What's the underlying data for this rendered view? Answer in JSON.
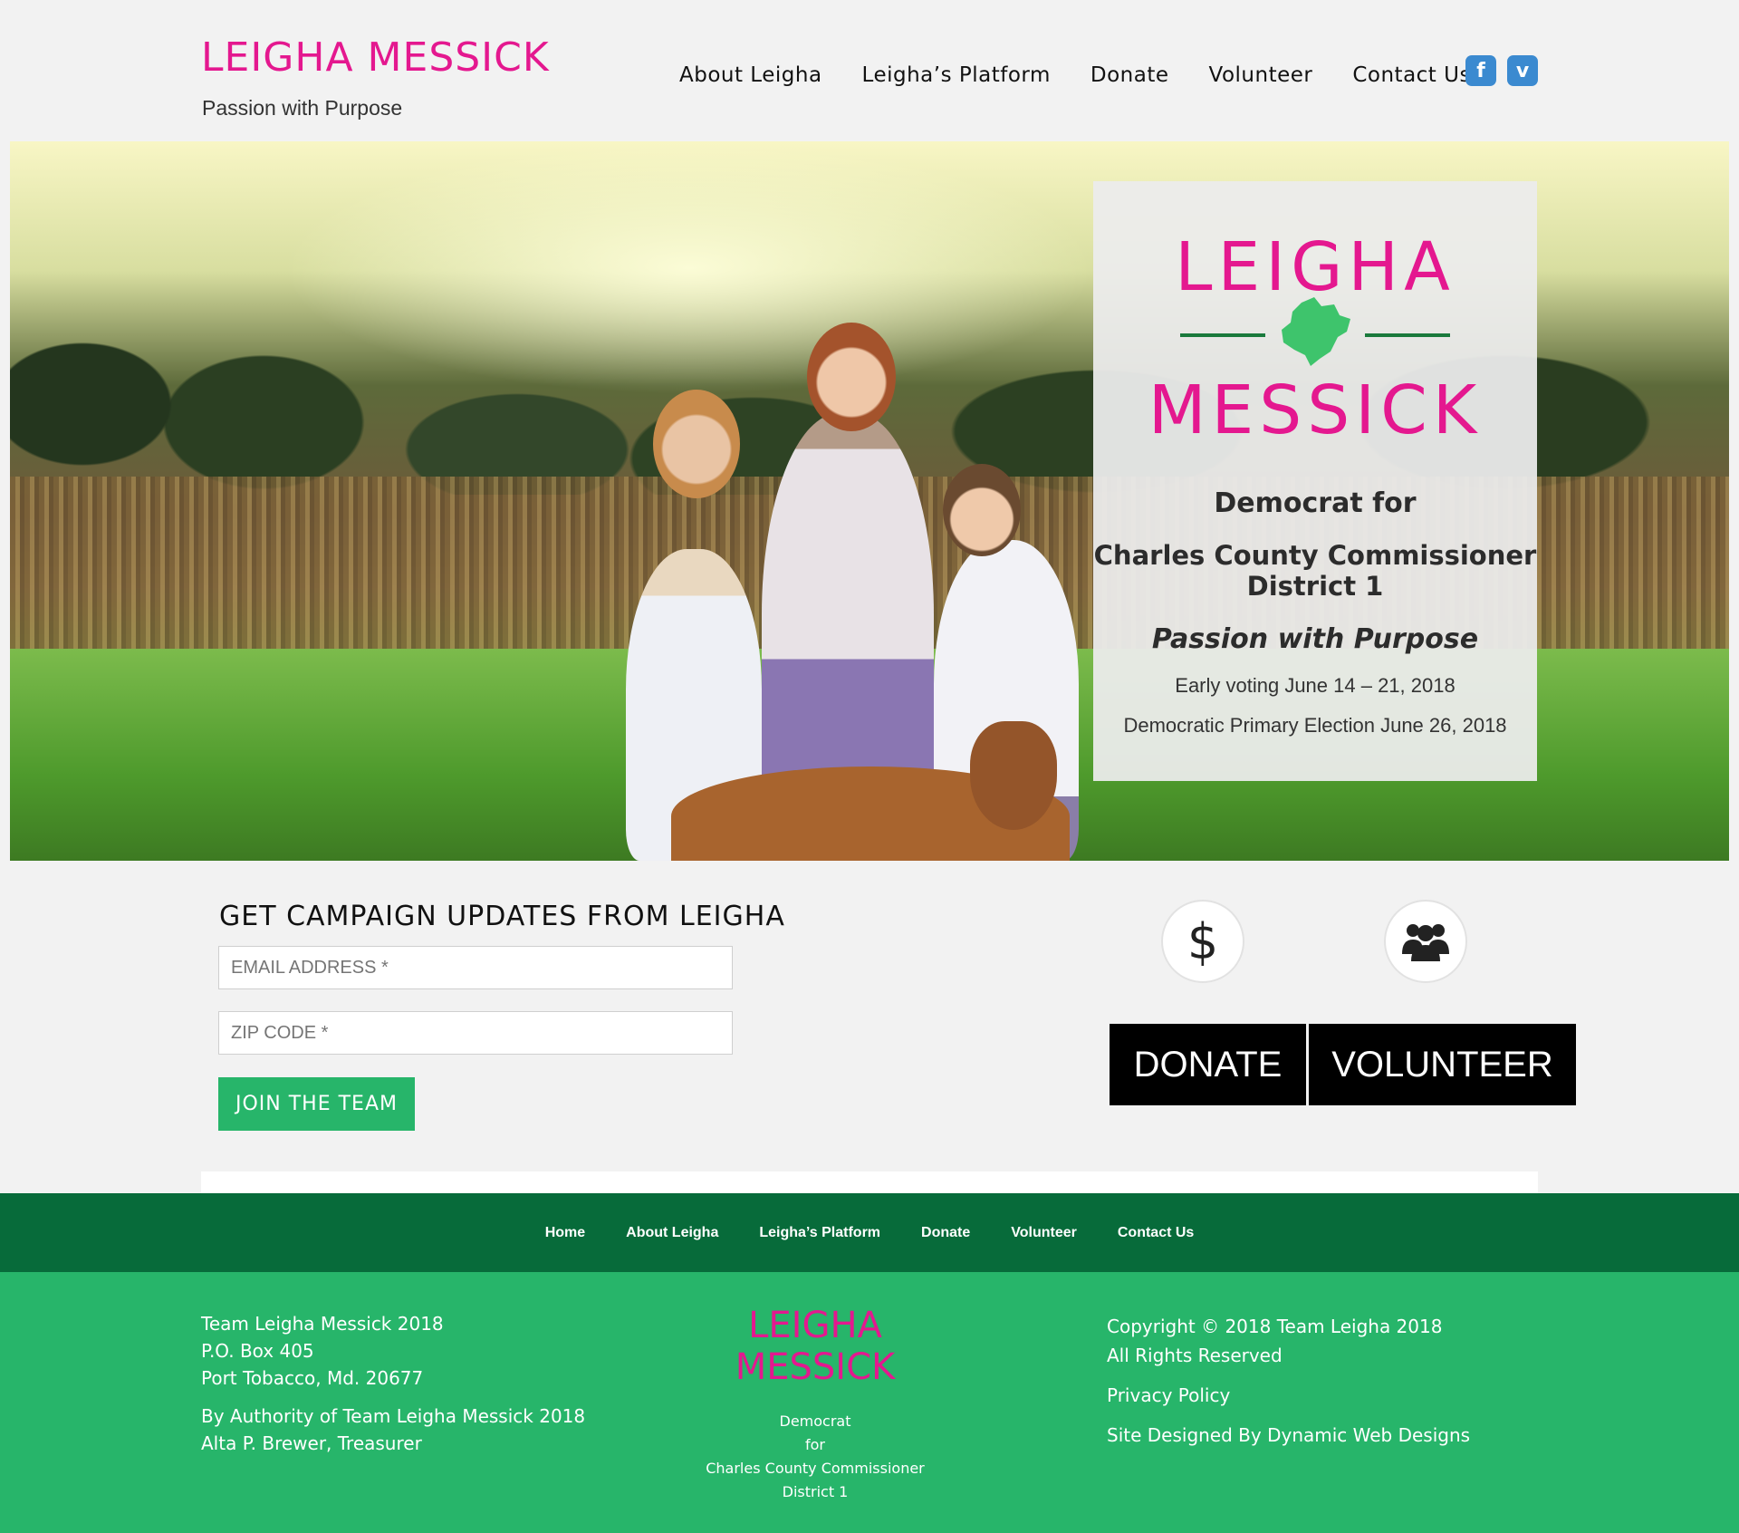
{
  "header": {
    "brand": "LEIGHA MESSICK",
    "tagline": "Passion with Purpose",
    "nav": [
      "About Leigha",
      "Leigha’s Platform",
      "Donate",
      "Volunteer",
      "Contact Us"
    ],
    "social": [
      {
        "icon": "facebook-icon",
        "glyph": "f"
      },
      {
        "icon": "vimeo-icon",
        "glyph": "v"
      }
    ]
  },
  "hero": {
    "logo_top": "LEIGHA",
    "logo_bottom": "MESSICK",
    "democrat_for": "Democrat for",
    "office_line1": "Charles County Commissioner",
    "office_line2": "District 1",
    "passion": "Passion with Purpose",
    "early_voting": "Early voting June 14 – 21, 2018",
    "primary": "Democratic Primary Election June 26, 2018"
  },
  "signup": {
    "title": "GET CAMPAIGN UPDATES FROM LEIGHA",
    "email_placeholder": "EMAIL ADDRESS *",
    "zip_placeholder": "ZIP CODE *",
    "button": "JOIN THE TEAM"
  },
  "cta": {
    "dollar_glyph": "$",
    "donate": "DONATE",
    "volunteer": "VOLUNTEER"
  },
  "footer_nav": [
    "Home",
    "About Leigha",
    "Leigha’s Platform",
    "Donate",
    "Volunteer",
    "Contact Us"
  ],
  "footer": {
    "address": [
      "Team Leigha Messick 2018",
      "P.O. Box 405",
      "Port Tobacco, Md. 20677"
    ],
    "authority": [
      "By Authority of Team Leigha Messick 2018",
      "Alta P. Brewer, Treasurer"
    ],
    "logo_line1": "LEIGHA",
    "logo_line2": "MESSICK",
    "sub": [
      "Democrat",
      "for",
      "Charles County Commissioner",
      "District 1"
    ],
    "copyright": [
      "Copyright © 2018 Team Leigha 2018",
      "All Rights Reserved"
    ],
    "privacy": "Privacy Policy",
    "designer": "Site Designed By Dynamic Web Designs"
  },
  "colors": {
    "brand_pink": "#e4188f",
    "green_dark": "#076b3a",
    "green": "#27b56a",
    "black": "#000000"
  }
}
